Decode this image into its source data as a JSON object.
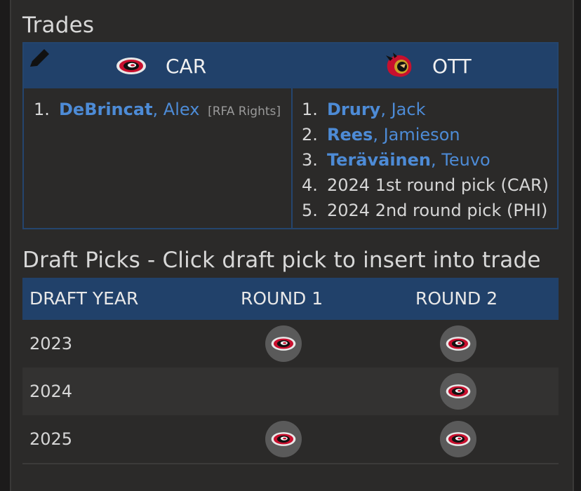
{
  "trades": {
    "title": "Trades",
    "teams": [
      {
        "abbr": "CAR",
        "logo_icon": "hurricanes-logo-icon",
        "items": [
          {
            "num": "1.",
            "last": "DeBrincat",
            "first": ", Alex",
            "note": "[RFA Rights]"
          }
        ]
      },
      {
        "abbr": "OTT",
        "logo_icon": "senators-logo-icon",
        "items": [
          {
            "num": "1.",
            "last": "Drury",
            "first": ", Jack"
          },
          {
            "num": "2.",
            "last": "Rees",
            "first": ", Jamieson"
          },
          {
            "num": "3.",
            "last": "Teräväinen",
            "first": ", Teuvo"
          },
          {
            "num": "4.",
            "text": "2024 1st round pick (CAR)"
          },
          {
            "num": "5.",
            "text": "2024 2nd round pick (PHI)"
          }
        ]
      }
    ],
    "edit_icon": "pencil-icon"
  },
  "draft_picks": {
    "title": "Draft Picks - Click draft pick to insert into trade",
    "columns": [
      "DRAFT YEAR",
      "ROUND 1",
      "ROUND 2"
    ],
    "rows": [
      {
        "year": "2023",
        "round1": true,
        "round2": true
      },
      {
        "year": "2024",
        "round1": false,
        "round2": true
      },
      {
        "year": "2025",
        "round1": true,
        "round2": true
      }
    ],
    "pick_icon": "hurricanes-logo-icon"
  },
  "colors": {
    "header_bg": "#21416a",
    "link": "#4d8bd6",
    "panel_bg": "#2b2a29"
  }
}
